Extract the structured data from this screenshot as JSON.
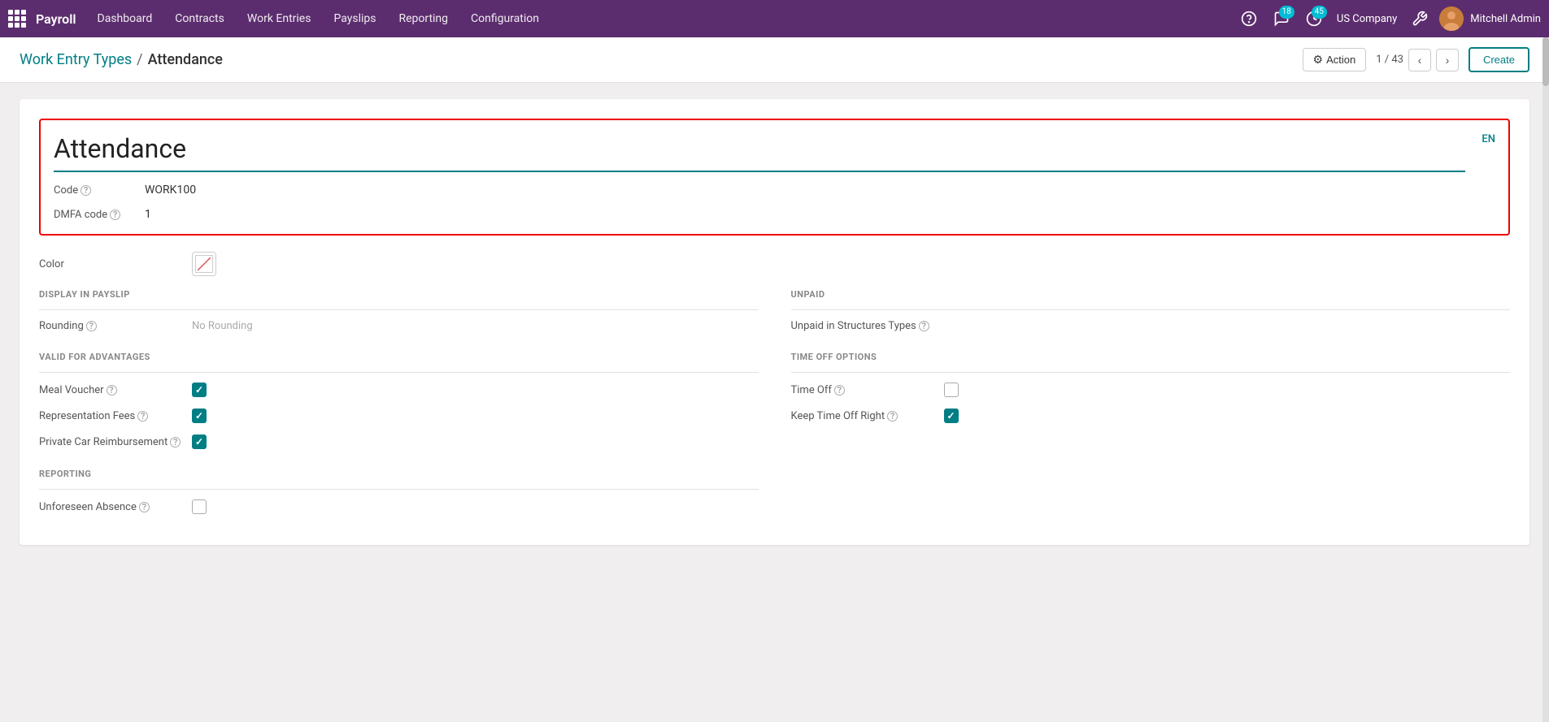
{
  "navbar": {
    "brand": "Payroll",
    "items": [
      {
        "label": "Dashboard",
        "id": "dashboard"
      },
      {
        "label": "Contracts",
        "id": "contracts"
      },
      {
        "label": "Work Entries",
        "id": "work-entries"
      },
      {
        "label": "Payslips",
        "id": "payslips"
      },
      {
        "label": "Reporting",
        "id": "reporting"
      },
      {
        "label": "Configuration",
        "id": "configuration"
      }
    ],
    "messages_count": "18",
    "clock_count": "45",
    "company": "US Company",
    "user": "Mitchell Admin"
  },
  "breadcrumb": {
    "parent": "Work Entry Types",
    "current": "Attendance"
  },
  "toolbar": {
    "action_label": "Action",
    "record_position": "1 / 43",
    "create_label": "Create"
  },
  "form": {
    "title": "Attendance",
    "lang_badge": "EN",
    "code_label": "Code",
    "code_help": "?",
    "code_value": "WORK100",
    "dmfa_label": "DMFA code",
    "dmfa_help": "?",
    "dmfa_value": "1",
    "color_label": "Color"
  },
  "display_in_payslip": {
    "section_title": "DISPLAY IN PAYSLIP",
    "rounding_label": "Rounding",
    "rounding_help": "?",
    "rounding_value": "No Rounding"
  },
  "unpaid": {
    "section_title": "UNPAID",
    "unpaid_label": "Unpaid in Structures Types",
    "unpaid_help": "?"
  },
  "valid_for_advantages": {
    "section_title": "VALID FOR ADVANTAGES",
    "meal_voucher_label": "Meal Voucher",
    "meal_voucher_help": "?",
    "meal_voucher_checked": true,
    "rep_fees_label": "Representation Fees",
    "rep_fees_help": "?",
    "rep_fees_checked": true,
    "private_car_label": "Private Car Reimbursement",
    "private_car_help": "?",
    "private_car_checked": true
  },
  "time_off_options": {
    "section_title": "TIME OFF OPTIONS",
    "time_off_label": "Time Off",
    "time_off_help": "?",
    "time_off_checked": false,
    "keep_time_off_label": "Keep Time Off Right",
    "keep_time_off_help": "?",
    "keep_time_off_checked": true
  },
  "reporting": {
    "section_title": "REPORTING",
    "unforeseen_label": "Unforeseen Absence",
    "unforeseen_help": "?",
    "unforeseen_checked": false
  }
}
